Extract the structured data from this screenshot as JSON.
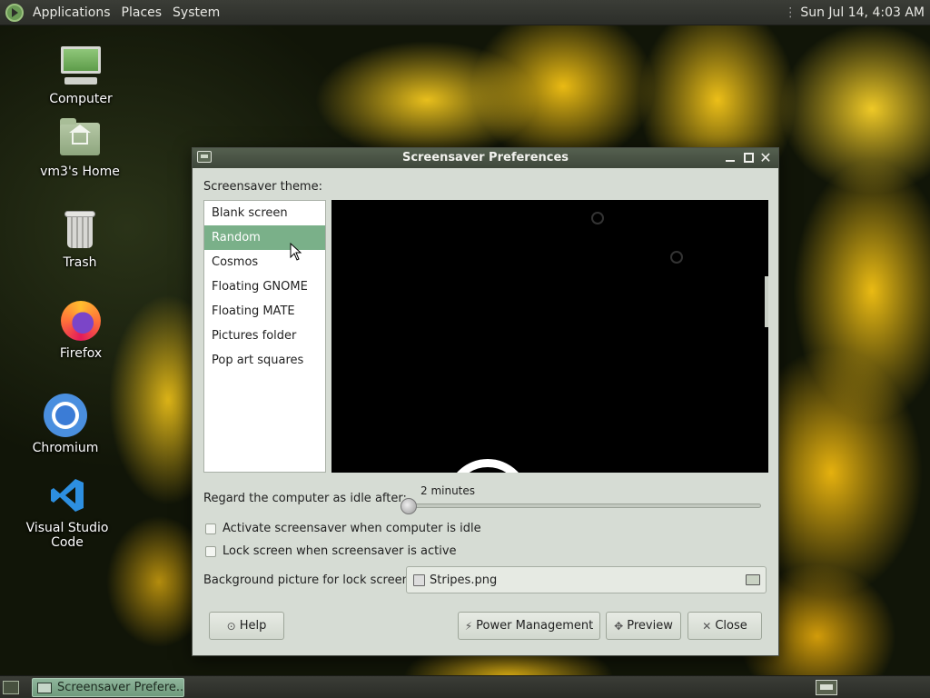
{
  "top_panel": {
    "menus": [
      "Applications",
      "Places",
      "System"
    ],
    "clock": "Sun Jul 14,  4:03 AM"
  },
  "desktop_icons": [
    {
      "label": "Computer",
      "icon": "computer-icon"
    },
    {
      "label": "vm3's Home",
      "icon": "home-folder-icon"
    },
    {
      "label": "Trash",
      "icon": "trash-icon"
    },
    {
      "label": "Firefox",
      "icon": "firefox-icon"
    },
    {
      "label": "Chromium",
      "icon": "chromium-icon"
    },
    {
      "label": "Visual Studio Code",
      "icon": "vscode-icon"
    }
  ],
  "dialog": {
    "title": "Screensaver Preferences",
    "theme_label": "Screensaver theme:",
    "themes": [
      "Blank screen",
      "Random",
      "Cosmos",
      "Floating GNOME",
      "Floating MATE",
      "Pictures folder",
      "Pop art squares"
    ],
    "selected_theme": "Random",
    "idle_label": "Regard the computer as idle after:",
    "idle_value": "2 minutes",
    "idle_slider_fraction": 0.0,
    "activate_label": "Activate screensaver when computer is idle",
    "activate_checked": false,
    "lock_label": "Lock screen when screensaver is active",
    "lock_checked": false,
    "background_label": "Background picture for lock screen:",
    "background_file": "Stripes.png",
    "buttons": {
      "help": "Help",
      "power": "Power Management",
      "preview": "Preview",
      "close": "Close"
    }
  },
  "bottom_panel": {
    "task_label": "Screensaver Prefere..."
  },
  "colors": {
    "selection": "#7ab089",
    "panel": "#2c2e29",
    "dialog_bg": "#d6dcd4"
  }
}
